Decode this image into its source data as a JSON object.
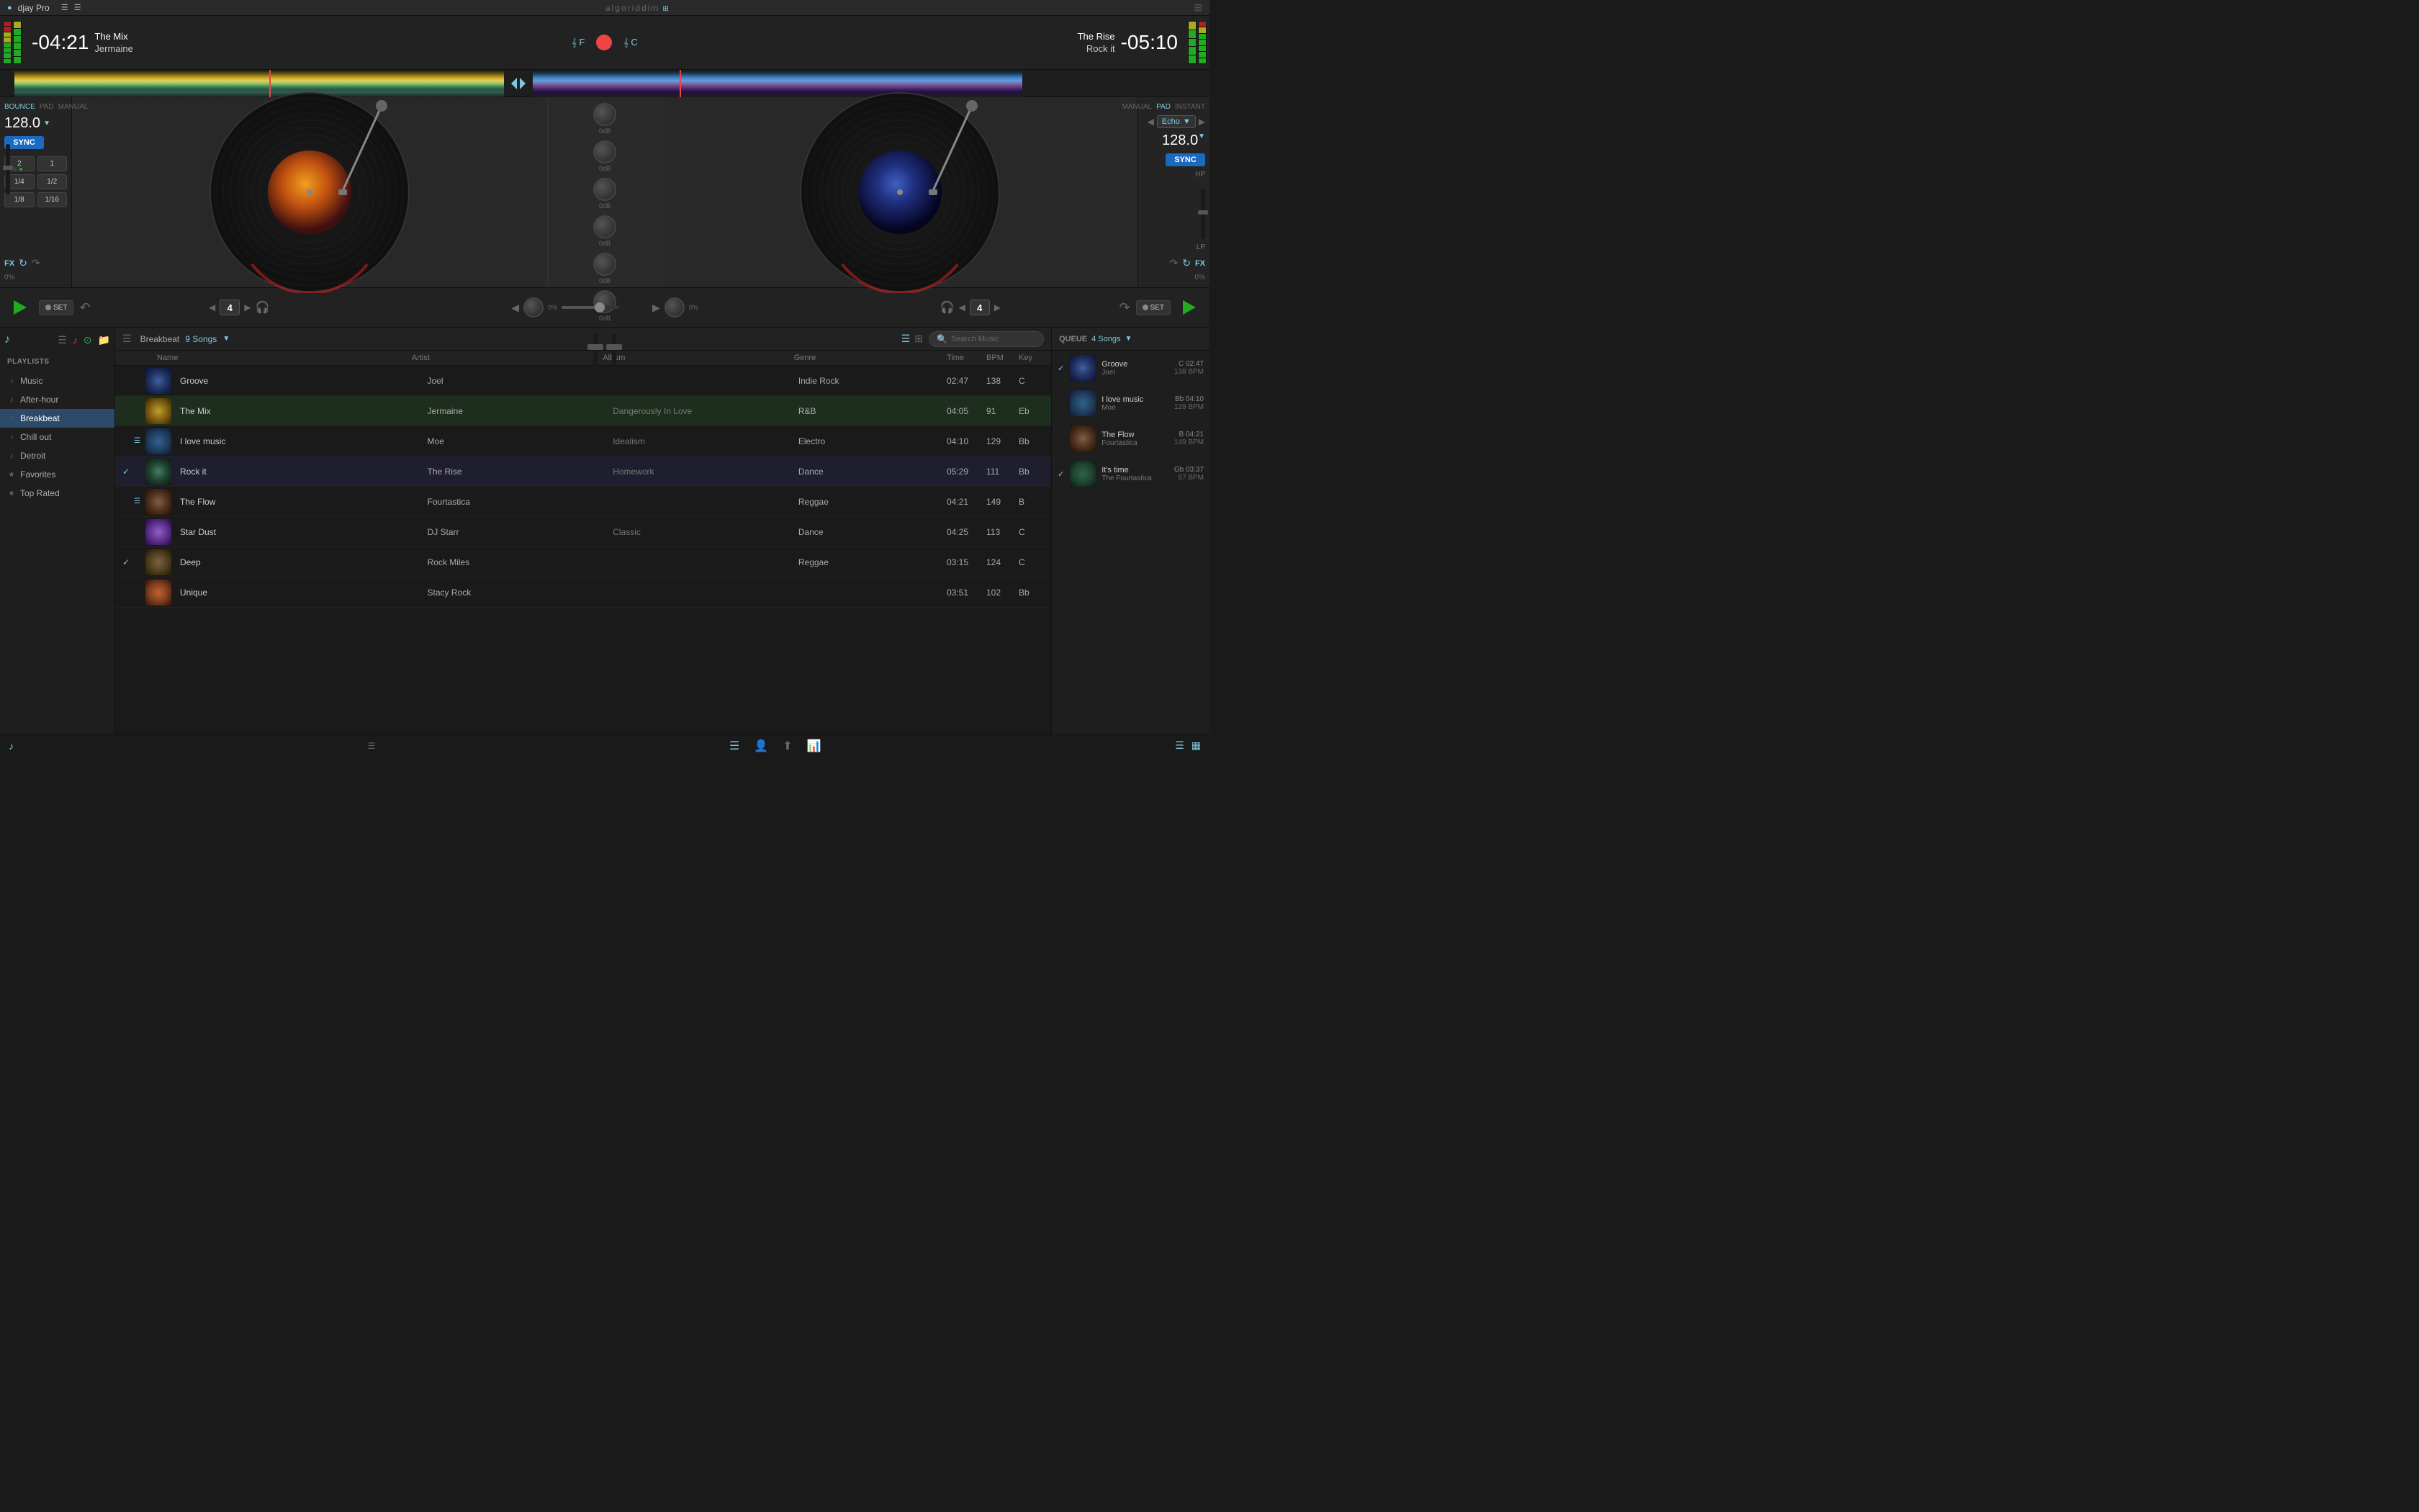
{
  "app": {
    "name": "djay Pro",
    "brand": "algoriddim",
    "version": ""
  },
  "topbar": {
    "app_label": "djay Pro",
    "brand_label": "algoriddim",
    "grid_icon": "grid-icon"
  },
  "deck_left": {
    "time": "-04:21",
    "track_name": "The Mix",
    "artist": "Jermaine",
    "key": "F",
    "bpm": "128.0",
    "sync_label": "SYNC",
    "bounce_label": "BOUNCE",
    "pad_label": "PAD",
    "manual_label": "MANUAL",
    "loop_values": [
      "2",
      "1",
      "1/4",
      "1/2",
      "1/8",
      "1/16"
    ],
    "fx_label": "FX",
    "percent": "0%",
    "set_label": "SET",
    "loop_count": "4"
  },
  "deck_right": {
    "time": "-05:10",
    "track_name": "Rock it",
    "artist": "The Rise",
    "key": "C",
    "bpm": "128.0",
    "sync_label": "SYNC",
    "manual_label": "MANUAL",
    "pad_label": "PAD",
    "instant_label": "INSTANT",
    "fx_label": "FX",
    "percent": "0%",
    "set_label": "SET",
    "loop_count": "4",
    "effect_name": "Echo",
    "hp_label": "HP",
    "lp_label": "LP"
  },
  "mixer": {
    "knob_labels": [
      "0dB",
      "0dB",
      "0dB",
      "0dB",
      "0dB",
      "0dB"
    ]
  },
  "library": {
    "playlist_label": "Breakbeat",
    "songs_count": "9 Songs",
    "search_placeholder": "Search Music",
    "columns": [
      "Name",
      "Artist",
      "Album",
      "Genre",
      "Time",
      "BPM",
      "Key"
    ],
    "tracks": [
      {
        "id": 1,
        "name": "Groove",
        "artist": "Joel",
        "album": "",
        "genre": "Indie Rock",
        "time": "02:47",
        "bpm": "138",
        "key": "C",
        "thumb_color": "#203060",
        "check": false,
        "queue_icon": false,
        "active": ""
      },
      {
        "id": 2,
        "name": "The Mix",
        "artist": "Jermaine",
        "album": "Dangerously In Love",
        "genre": "R&B",
        "time": "04:05",
        "bpm": "91",
        "key": "Eb",
        "thumb_color": "#605020",
        "check": false,
        "queue_icon": false,
        "active": "left"
      },
      {
        "id": 3,
        "name": "I love music",
        "artist": "Moe",
        "album": "Idealism",
        "genre": "Electro",
        "time": "04:10",
        "bpm": "129",
        "key": "Bb",
        "thumb_color": "#204060",
        "check": false,
        "queue_icon": true,
        "active": ""
      },
      {
        "id": 4,
        "name": "Rock it",
        "artist": "The Rise",
        "album": "Homework",
        "genre": "Dance",
        "time": "05:29",
        "bpm": "111",
        "key": "Bb",
        "thumb_color": "#204030",
        "check": true,
        "queue_icon": false,
        "active": "right"
      },
      {
        "id": 5,
        "name": "The Flow",
        "artist": "Fourtastica",
        "album": "",
        "genre": "Reggae",
        "time": "04:21",
        "bpm": "149",
        "key": "B",
        "thumb_color": "#302010",
        "check": false,
        "queue_icon": true,
        "active": ""
      },
      {
        "id": 6,
        "name": "Star Dust",
        "artist": "DJ Starr",
        "album": "Classic",
        "genre": "Dance",
        "time": "04:25",
        "bpm": "113",
        "key": "C",
        "thumb_color": "#402060",
        "check": false,
        "queue_icon": false,
        "active": ""
      },
      {
        "id": 7,
        "name": "Deep",
        "artist": "Rock Miles",
        "album": "",
        "genre": "Reggae",
        "time": "03:15",
        "bpm": "124",
        "key": "C",
        "thumb_color": "#403020",
        "check": true,
        "queue_icon": false,
        "active": ""
      },
      {
        "id": 8,
        "name": "Unique",
        "artist": "Stacy Rock",
        "album": "",
        "genre": "",
        "time": "03:51",
        "bpm": "102",
        "key": "Bb",
        "thumb_color": "#604020",
        "check": false,
        "queue_icon": false,
        "active": ""
      }
    ]
  },
  "sidebar": {
    "header": "PLAYLISTS",
    "items": [
      {
        "label": "Music",
        "icon": "♪",
        "active": false
      },
      {
        "label": "After-hour",
        "icon": "♪",
        "active": false
      },
      {
        "label": "Breakbeat",
        "icon": "♪",
        "active": true
      },
      {
        "label": "Chill out",
        "icon": "♪",
        "active": false
      },
      {
        "label": "Detroit",
        "icon": "♪",
        "active": false
      },
      {
        "label": "Favorites",
        "icon": "★",
        "active": false
      },
      {
        "label": "Top Rated",
        "icon": "★",
        "active": false
      }
    ]
  },
  "queue": {
    "label": "QUEUE",
    "count": "4 Songs",
    "items": [
      {
        "title": "Groove",
        "artist": "Joel",
        "key": "C",
        "time": "02:47",
        "bpm": "138 BPM",
        "check": true,
        "thumb_color": "#203060"
      },
      {
        "title": "I love music",
        "artist": "Moe",
        "key": "Bb",
        "time": "04:10",
        "bpm": "129 BPM",
        "check": false,
        "thumb_color": "#204060"
      },
      {
        "title": "The Flow",
        "artist": "Fourtastica",
        "key": "B",
        "time": "04:21",
        "bpm": "149 BPM",
        "check": false,
        "thumb_color": "#302010"
      },
      {
        "title": "It's time",
        "artist": "The Fourtastica",
        "key": "Gb",
        "time": "03:37",
        "bpm": "87 BPM",
        "check": true,
        "thumb_color": "#204530"
      }
    ]
  },
  "status": {
    "music_icon": "♪",
    "center_icons": [
      "list-icon",
      "person-icon",
      "grid-icon",
      "chart-icon"
    ],
    "right_icons": [
      "list2-icon",
      "bars-icon"
    ]
  }
}
